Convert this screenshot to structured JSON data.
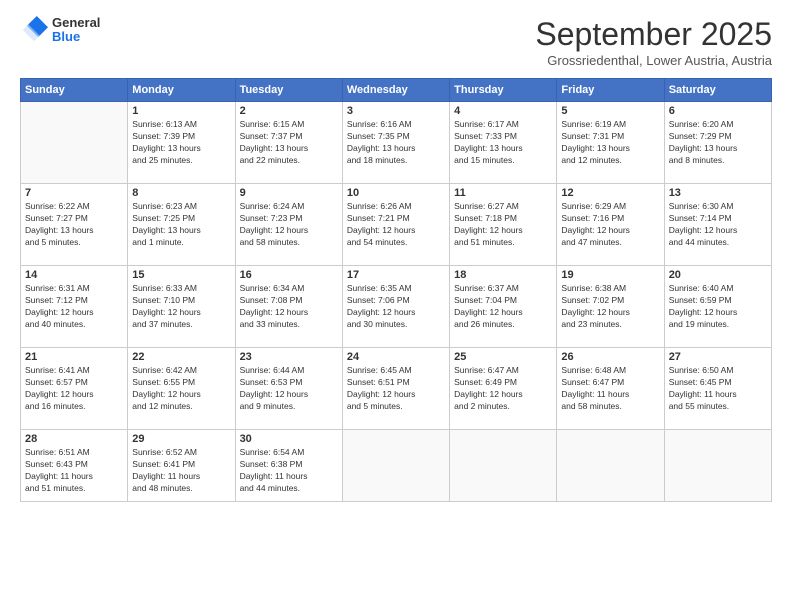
{
  "header": {
    "logo": {
      "general": "General",
      "blue": "Blue"
    },
    "title": "September 2025",
    "location": "Grossriedenthal, Lower Austria, Austria"
  },
  "weekdays": [
    "Sunday",
    "Monday",
    "Tuesday",
    "Wednesday",
    "Thursday",
    "Friday",
    "Saturday"
  ],
  "weeks": [
    [
      {
        "day": "",
        "info": ""
      },
      {
        "day": "1",
        "info": "Sunrise: 6:13 AM\nSunset: 7:39 PM\nDaylight: 13 hours\nand 25 minutes."
      },
      {
        "day": "2",
        "info": "Sunrise: 6:15 AM\nSunset: 7:37 PM\nDaylight: 13 hours\nand 22 minutes."
      },
      {
        "day": "3",
        "info": "Sunrise: 6:16 AM\nSunset: 7:35 PM\nDaylight: 13 hours\nand 18 minutes."
      },
      {
        "day": "4",
        "info": "Sunrise: 6:17 AM\nSunset: 7:33 PM\nDaylight: 13 hours\nand 15 minutes."
      },
      {
        "day": "5",
        "info": "Sunrise: 6:19 AM\nSunset: 7:31 PM\nDaylight: 13 hours\nand 12 minutes."
      },
      {
        "day": "6",
        "info": "Sunrise: 6:20 AM\nSunset: 7:29 PM\nDaylight: 13 hours\nand 8 minutes."
      }
    ],
    [
      {
        "day": "7",
        "info": "Sunrise: 6:22 AM\nSunset: 7:27 PM\nDaylight: 13 hours\nand 5 minutes."
      },
      {
        "day": "8",
        "info": "Sunrise: 6:23 AM\nSunset: 7:25 PM\nDaylight: 13 hours\nand 1 minute."
      },
      {
        "day": "9",
        "info": "Sunrise: 6:24 AM\nSunset: 7:23 PM\nDaylight: 12 hours\nand 58 minutes."
      },
      {
        "day": "10",
        "info": "Sunrise: 6:26 AM\nSunset: 7:21 PM\nDaylight: 12 hours\nand 54 minutes."
      },
      {
        "day": "11",
        "info": "Sunrise: 6:27 AM\nSunset: 7:18 PM\nDaylight: 12 hours\nand 51 minutes."
      },
      {
        "day": "12",
        "info": "Sunrise: 6:29 AM\nSunset: 7:16 PM\nDaylight: 12 hours\nand 47 minutes."
      },
      {
        "day": "13",
        "info": "Sunrise: 6:30 AM\nSunset: 7:14 PM\nDaylight: 12 hours\nand 44 minutes."
      }
    ],
    [
      {
        "day": "14",
        "info": "Sunrise: 6:31 AM\nSunset: 7:12 PM\nDaylight: 12 hours\nand 40 minutes."
      },
      {
        "day": "15",
        "info": "Sunrise: 6:33 AM\nSunset: 7:10 PM\nDaylight: 12 hours\nand 37 minutes."
      },
      {
        "day": "16",
        "info": "Sunrise: 6:34 AM\nSunset: 7:08 PM\nDaylight: 12 hours\nand 33 minutes."
      },
      {
        "day": "17",
        "info": "Sunrise: 6:35 AM\nSunset: 7:06 PM\nDaylight: 12 hours\nand 30 minutes."
      },
      {
        "day": "18",
        "info": "Sunrise: 6:37 AM\nSunset: 7:04 PM\nDaylight: 12 hours\nand 26 minutes."
      },
      {
        "day": "19",
        "info": "Sunrise: 6:38 AM\nSunset: 7:02 PM\nDaylight: 12 hours\nand 23 minutes."
      },
      {
        "day": "20",
        "info": "Sunrise: 6:40 AM\nSunset: 6:59 PM\nDaylight: 12 hours\nand 19 minutes."
      }
    ],
    [
      {
        "day": "21",
        "info": "Sunrise: 6:41 AM\nSunset: 6:57 PM\nDaylight: 12 hours\nand 16 minutes."
      },
      {
        "day": "22",
        "info": "Sunrise: 6:42 AM\nSunset: 6:55 PM\nDaylight: 12 hours\nand 12 minutes."
      },
      {
        "day": "23",
        "info": "Sunrise: 6:44 AM\nSunset: 6:53 PM\nDaylight: 12 hours\nand 9 minutes."
      },
      {
        "day": "24",
        "info": "Sunrise: 6:45 AM\nSunset: 6:51 PM\nDaylight: 12 hours\nand 5 minutes."
      },
      {
        "day": "25",
        "info": "Sunrise: 6:47 AM\nSunset: 6:49 PM\nDaylight: 12 hours\nand 2 minutes."
      },
      {
        "day": "26",
        "info": "Sunrise: 6:48 AM\nSunset: 6:47 PM\nDaylight: 11 hours\nand 58 minutes."
      },
      {
        "day": "27",
        "info": "Sunrise: 6:50 AM\nSunset: 6:45 PM\nDaylight: 11 hours\nand 55 minutes."
      }
    ],
    [
      {
        "day": "28",
        "info": "Sunrise: 6:51 AM\nSunset: 6:43 PM\nDaylight: 11 hours\nand 51 minutes."
      },
      {
        "day": "29",
        "info": "Sunrise: 6:52 AM\nSunset: 6:41 PM\nDaylight: 11 hours\nand 48 minutes."
      },
      {
        "day": "30",
        "info": "Sunrise: 6:54 AM\nSunset: 6:38 PM\nDaylight: 11 hours\nand 44 minutes."
      },
      {
        "day": "",
        "info": ""
      },
      {
        "day": "",
        "info": ""
      },
      {
        "day": "",
        "info": ""
      },
      {
        "day": "",
        "info": ""
      }
    ]
  ]
}
